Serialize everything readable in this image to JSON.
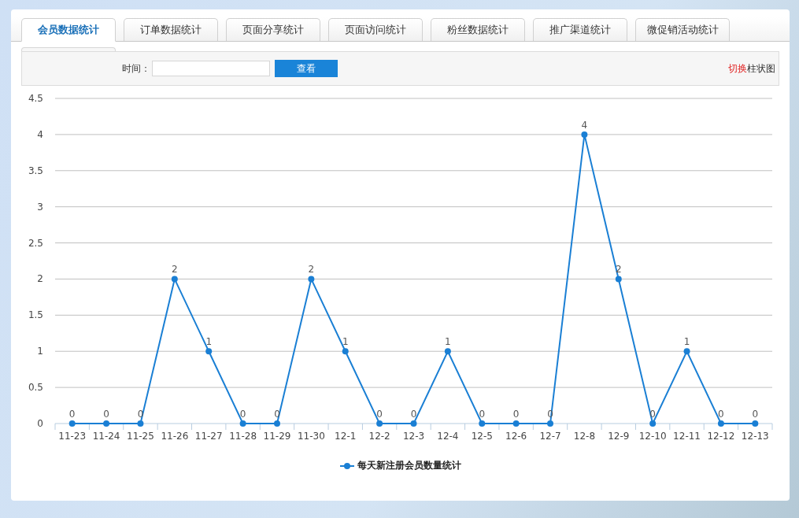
{
  "tabs": [
    {
      "label": "会员数据统计",
      "selected": true
    },
    {
      "label": "订单数据统计",
      "selected": false
    },
    {
      "label": "页面分享统计",
      "selected": false
    },
    {
      "label": "页面访问统计",
      "selected": false
    },
    {
      "label": "粉丝数据统计",
      "selected": false
    },
    {
      "label": "推广渠道统计",
      "selected": false
    },
    {
      "label": "微促销活动统计",
      "selected": false
    }
  ],
  "filter": {
    "label": "时间：",
    "button": "查看"
  },
  "switch_link": {
    "action": "切换",
    "target": "柱状图"
  },
  "chart": {
    "chart_data": {
      "type": "line",
      "categories": [
        "11-23",
        "11-24",
        "11-25",
        "11-26",
        "11-27",
        "11-28",
        "11-29",
        "11-30",
        "12-1",
        "12-2",
        "12-3",
        "12-4",
        "12-5",
        "12-6",
        "12-7",
        "12-8",
        "12-9",
        "12-10",
        "12-11",
        "12-12",
        "12-13"
      ],
      "series": [
        {
          "name": "每天新注册会员数量统计",
          "color": "#1a7fd4",
          "marker": true,
          "values": [
            0,
            0,
            0,
            2,
            1,
            0,
            0,
            2,
            1,
            0,
            0,
            1,
            0,
            0,
            0,
            4,
            2,
            0,
            1,
            0,
            0
          ]
        }
      ],
      "ylim": [
        0,
        4.5
      ],
      "yticks": [
        0,
        0.5,
        1,
        1.5,
        2,
        2.5,
        3,
        3.5,
        4,
        4.5
      ],
      "grid": true,
      "data_labels": true
    }
  }
}
